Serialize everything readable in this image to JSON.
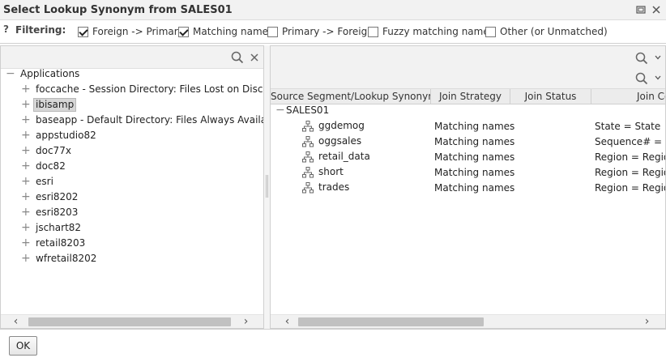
{
  "window": {
    "title": "Select Lookup Synonym from SALES01",
    "restore_icon": "restore-icon",
    "close_icon": "close-icon"
  },
  "filterbar": {
    "help": "?",
    "label": "Filtering:",
    "options": [
      {
        "label": "Foreign -> Primary",
        "checked": true
      },
      {
        "label": "Matching names",
        "checked": true
      },
      {
        "label": "Primary -> Foreign",
        "checked": false
      },
      {
        "label": "Fuzzy matching names",
        "checked": false
      },
      {
        "label": "Other (or Unmatched)",
        "checked": false
      }
    ]
  },
  "left_tree": {
    "root": {
      "label": "Applications",
      "expander": "−"
    },
    "items": [
      {
        "label": "foccache - Session Directory: Files Lost on Disconnect",
        "expander": "+",
        "selected": false
      },
      {
        "label": "ibisamp",
        "expander": "+",
        "selected": true
      },
      {
        "label": "baseapp - Default Directory: Files Always Available",
        "expander": "+",
        "selected": false
      },
      {
        "label": "appstudio82",
        "expander": "+",
        "selected": false
      },
      {
        "label": "doc77x",
        "expander": "+",
        "selected": false
      },
      {
        "label": "doc82",
        "expander": "+",
        "selected": false
      },
      {
        "label": "esri",
        "expander": "+",
        "selected": false
      },
      {
        "label": "esri8202",
        "expander": "+",
        "selected": false
      },
      {
        "label": "esri8203",
        "expander": "+",
        "selected": false
      },
      {
        "label": "jschart82",
        "expander": "+",
        "selected": false
      },
      {
        "label": "retail8203",
        "expander": "+",
        "selected": false
      },
      {
        "label": "wfretail8202",
        "expander": "+",
        "selected": false
      }
    ],
    "scroll_left": "‹",
    "scroll_right": "›"
  },
  "right_grid": {
    "columns": [
      "Source Segment/Lookup Synonym",
      "Join Strategy",
      "Join Status",
      "Join Conditions"
    ],
    "group": {
      "label": "SALES01",
      "expander": "−"
    },
    "rows": [
      {
        "name": "ggdemog",
        "strategy": "Matching names",
        "condition": "State = State"
      },
      {
        "name": "oggsales",
        "strategy": "Matching names",
        "condition": "Sequence# = Se"
      },
      {
        "name": "retail_data",
        "strategy": "Matching names",
        "condition": "Region = Region"
      },
      {
        "name": "short",
        "strategy": "Matching names",
        "condition": "Region = Region"
      },
      {
        "name": "trades",
        "strategy": "Matching names",
        "condition": "Region = Region"
      }
    ],
    "scroll_left": "‹",
    "scroll_right": "›"
  },
  "footer": {
    "ok_label": "OK"
  }
}
